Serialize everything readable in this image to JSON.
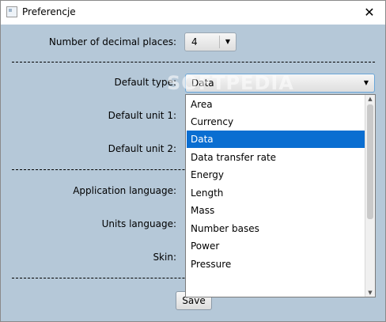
{
  "window": {
    "title": "Preferencje"
  },
  "decimal": {
    "label": "Number of decimal places:",
    "value": "4"
  },
  "default_type": {
    "label": "Default type:",
    "value": "Data"
  },
  "default_unit1": {
    "label": "Default unit 1:"
  },
  "default_unit2": {
    "label": "Default unit 2:"
  },
  "app_language": {
    "label": "Application language:"
  },
  "units_language": {
    "label": "Units language:"
  },
  "skin": {
    "label": "Skin:"
  },
  "dropdown": {
    "options": [
      "Area",
      "Currency",
      "Data",
      "Data transfer rate",
      "Energy",
      "Length",
      "Mass",
      "Number bases",
      "Power",
      "Pressure"
    ],
    "selected": "Data"
  },
  "buttons": {
    "save": "Save"
  },
  "watermark": "SOFTPEDIA",
  "colors": {
    "background": "#b5c8d8",
    "selection": "#0a6ed1"
  },
  "icons": {
    "close": "close-icon",
    "app": "app-icon",
    "dropdown": "chevron-down-icon"
  }
}
